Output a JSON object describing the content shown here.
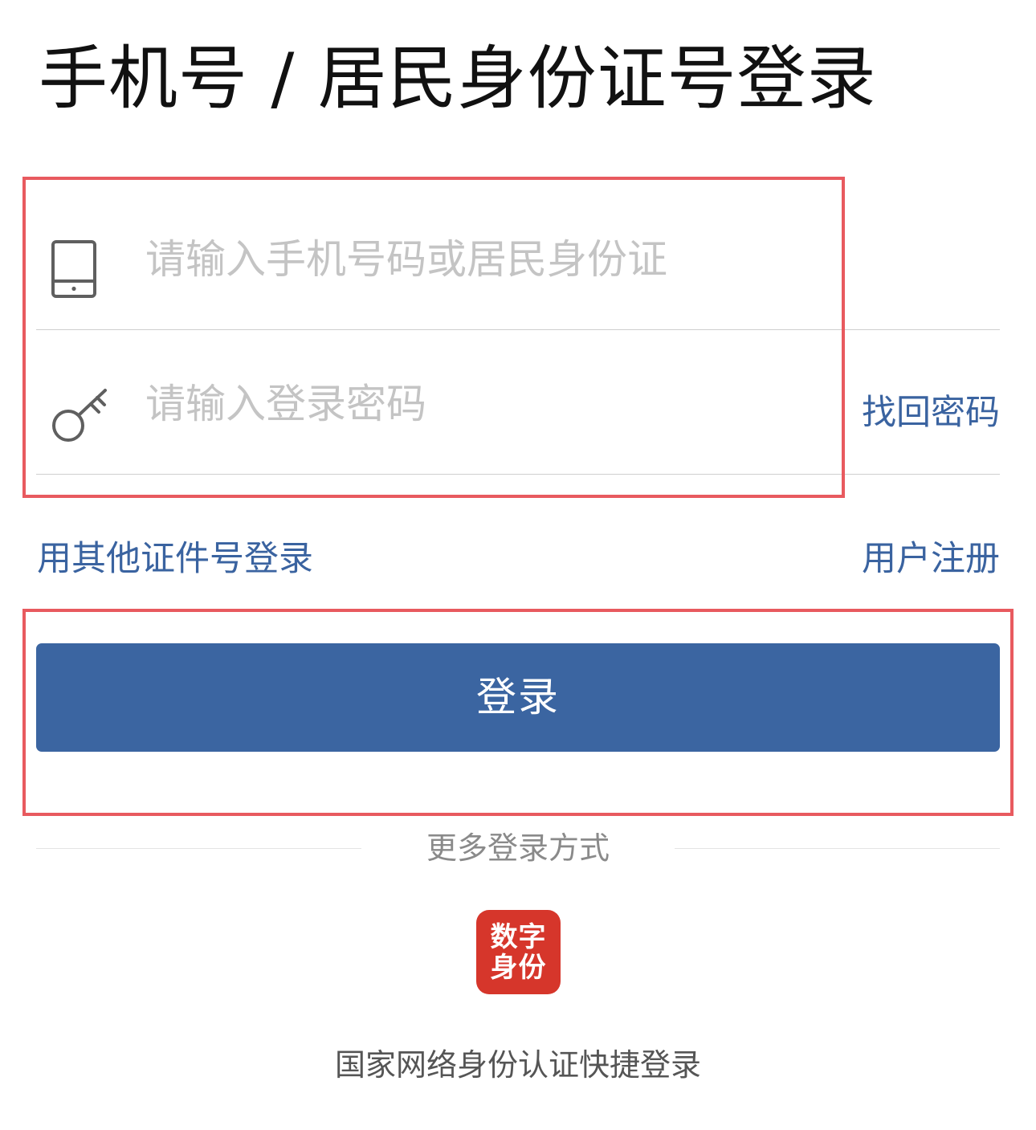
{
  "page": {
    "title": "手机号 / 居民身份证号登录"
  },
  "form": {
    "account_field": {
      "icon": "tablet-icon",
      "placeholder": "请输入手机号码或居民身份证",
      "value": ""
    },
    "password_field": {
      "icon": "key-icon",
      "placeholder": "请输入登录密码",
      "value": ""
    },
    "forgot_password_label": "找回密码"
  },
  "links": {
    "other_id_login": "用其他证件号登录",
    "register": "用户注册"
  },
  "login_button_label": "登录",
  "more_methods": {
    "label": "更多登录方式",
    "digital_id_logo": {
      "line1": "数字",
      "line2": "身份",
      "icon": "digital-id-logo",
      "color": "#d6362b"
    },
    "digital_id_caption": "国家网络身份认证快捷登录"
  },
  "colors": {
    "accent": "#3b65a1",
    "link": "#3a63a0",
    "highlight": "#e85a5f"
  }
}
